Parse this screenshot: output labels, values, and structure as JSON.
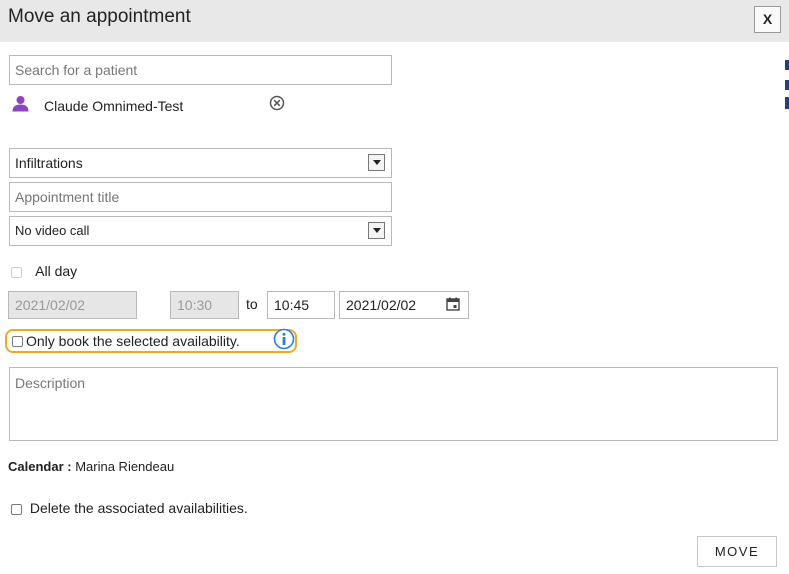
{
  "dialog": {
    "title": "Move an appointment",
    "close_label": "X"
  },
  "patient": {
    "search_placeholder": "Search for a patient",
    "selected_name": "Claude Omnimed-Test"
  },
  "appointment_type": {
    "selected": "Infiltrations"
  },
  "appointment_title": {
    "placeholder": "Appointment title"
  },
  "video_call": {
    "selected": "No video call"
  },
  "all_day": {
    "label": "All day",
    "checked": false,
    "disabled": true
  },
  "schedule": {
    "start_date": "2021/02/02",
    "start_time": "10:30",
    "to_label": "to",
    "end_time": "10:45",
    "end_date": "2021/02/02"
  },
  "only_book": {
    "label": "Only book the selected availability.",
    "checked": false
  },
  "description": {
    "placeholder": "Description"
  },
  "calendar": {
    "label": "Calendar :",
    "value": "Marina Riendeau"
  },
  "delete_associated": {
    "label": "Delete the associated availabilities.",
    "checked": false
  },
  "actions": {
    "move_label": "MOVE"
  },
  "colors": {
    "accent_orange": "#f0a820",
    "info_blue": "#2a7ee0",
    "person_purple": "#8e44c4",
    "header_bg": "#e8e8e8"
  },
  "icons": [
    "person-icon",
    "remove-icon",
    "dropdown-arrow-icon",
    "calendar-icon",
    "info-icon"
  ]
}
